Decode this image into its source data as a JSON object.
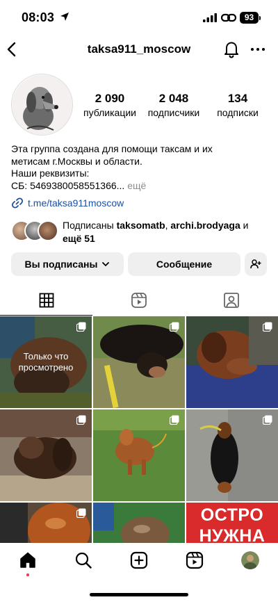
{
  "status_bar": {
    "time": "08:03",
    "battery": "93",
    "icons": [
      "location-arrow-icon",
      "cellular-signal-icon",
      "personal-hotspot-icon",
      "battery-icon"
    ]
  },
  "nav": {
    "username": "taksa911_moscow",
    "icons": [
      "back-icon",
      "bell-icon",
      "more-icon"
    ]
  },
  "stats": [
    {
      "value": "2 090",
      "label": "публикации"
    },
    {
      "value": "2 048",
      "label": "подписчики"
    },
    {
      "value": "134",
      "label": "подписки"
    }
  ],
  "bio": {
    "line1": "Эта группа создана для помощи таксам и их",
    "line2": "метисам г.Москвы и области.",
    "line3": "Наши реквизиты:",
    "line4": "СБ: 5469380058551366...",
    "more": " ещё"
  },
  "link": {
    "text": "t.me/taksa911moscow"
  },
  "followed_by": {
    "prefix": "Подписаны ",
    "user1": "taksomatb",
    "sep": ", ",
    "user2": "archi.brodyaga",
    "mid": " и",
    "rest": "ещё 51"
  },
  "buttons": {
    "following": "Вы подписаны",
    "message": "Сообщение"
  },
  "tabs": [
    "grid-icon",
    "reels-icon",
    "tagged-icon"
  ],
  "grid": {
    "viewed_label_1": "Только что",
    "viewed_label_2": "просмотрено",
    "banner_line1": "ОСТРО",
    "banner_line2": "НУЖНА"
  },
  "bottom_nav": [
    "home-icon",
    "search-icon",
    "create-icon",
    "reels-icon",
    "profile-avatar"
  ],
  "colors": {
    "link": "#1d4fa0",
    "button_bg": "#efefef",
    "notification_dot": "#ff3040",
    "banner_red": "#d92b2b"
  }
}
